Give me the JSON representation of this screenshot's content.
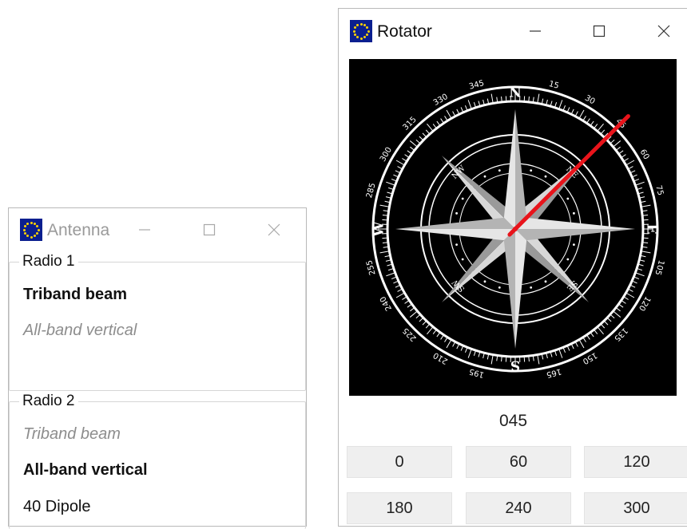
{
  "antenna_window": {
    "title": "Antenna",
    "groups": [
      {
        "label": "Radio 1",
        "items": [
          {
            "text": "Triband beam",
            "style": "bold"
          },
          {
            "text": "All-band vertical",
            "style": "dim"
          }
        ]
      },
      {
        "label": "Radio 2",
        "items": [
          {
            "text": "Triband beam",
            "style": "dim"
          },
          {
            "text": "All-band vertical",
            "style": "bold"
          },
          {
            "text": "40 Dipole",
            "style": "normal"
          }
        ]
      }
    ]
  },
  "rotator_window": {
    "title": "Rotator",
    "compass": {
      "cardinals": [
        "N",
        "E",
        "S",
        "W"
      ],
      "intercardinals": [
        "NE",
        "SE",
        "SW",
        "NW"
      ],
      "degree_labels": [
        "15",
        "30",
        "45",
        "60",
        "75",
        "105",
        "120",
        "135",
        "150",
        "165",
        "195",
        "210",
        "225",
        "240",
        "255",
        "285",
        "300",
        "315",
        "330",
        "345"
      ],
      "pointer_bearing_deg": 45,
      "pointer_color": "#e8141b"
    },
    "heading_value": "045",
    "preset_buttons": [
      "0",
      "60",
      "120",
      "180",
      "240",
      "300"
    ]
  },
  "icons": {
    "app": "eu-flag-icon",
    "minimize": "minimize-icon",
    "maximize": "maximize-icon",
    "close": "close-icon"
  }
}
